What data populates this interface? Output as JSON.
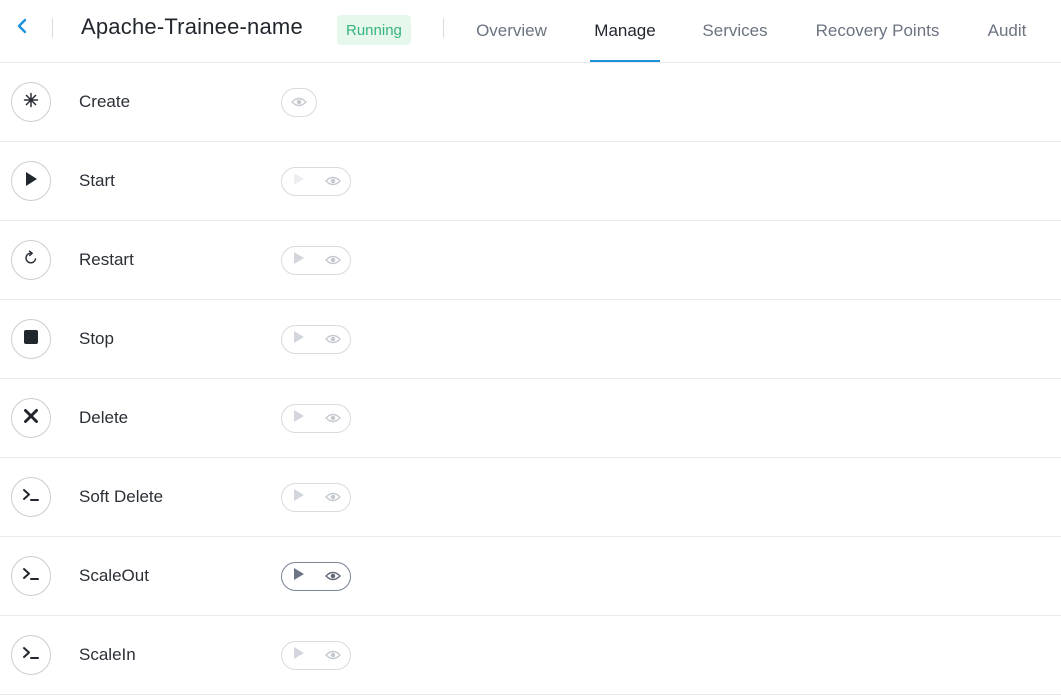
{
  "header": {
    "back_icon": "chevron-left-icon",
    "title": "Apache-Trainee-name",
    "status": "Running",
    "status_color": "#36b37e",
    "tabs": [
      {
        "label": "Overview",
        "active": false
      },
      {
        "label": "Manage",
        "active": true
      },
      {
        "label": "Services",
        "active": false
      },
      {
        "label": "Recovery Points",
        "active": false
      },
      {
        "label": "Audit",
        "active": false
      }
    ],
    "accent_color": "#1b93d8"
  },
  "actions": [
    {
      "label": "Create",
      "icon": "sparkle-icon",
      "controls": [
        "eye"
      ],
      "state": "disabled"
    },
    {
      "label": "Start",
      "icon": "play-icon",
      "controls": [
        "play",
        "eye"
      ],
      "state": "disabled"
    },
    {
      "label": "Restart",
      "icon": "restart-icon",
      "controls": [
        "play",
        "eye"
      ],
      "state": "disabled"
    },
    {
      "label": "Stop",
      "icon": "stop-icon",
      "controls": [
        "play",
        "eye"
      ],
      "state": "disabled"
    },
    {
      "label": "Delete",
      "icon": "close-icon",
      "controls": [
        "play",
        "eye"
      ],
      "state": "disabled"
    },
    {
      "label": "Soft Delete",
      "icon": "terminal-icon",
      "controls": [
        "play",
        "eye"
      ],
      "state": "disabled"
    },
    {
      "label": "ScaleOut",
      "icon": "terminal-icon",
      "controls": [
        "play",
        "eye"
      ],
      "state": "enabled"
    },
    {
      "label": "ScaleIn",
      "icon": "terminal-icon",
      "controls": [
        "play",
        "eye"
      ],
      "state": "disabled"
    }
  ]
}
